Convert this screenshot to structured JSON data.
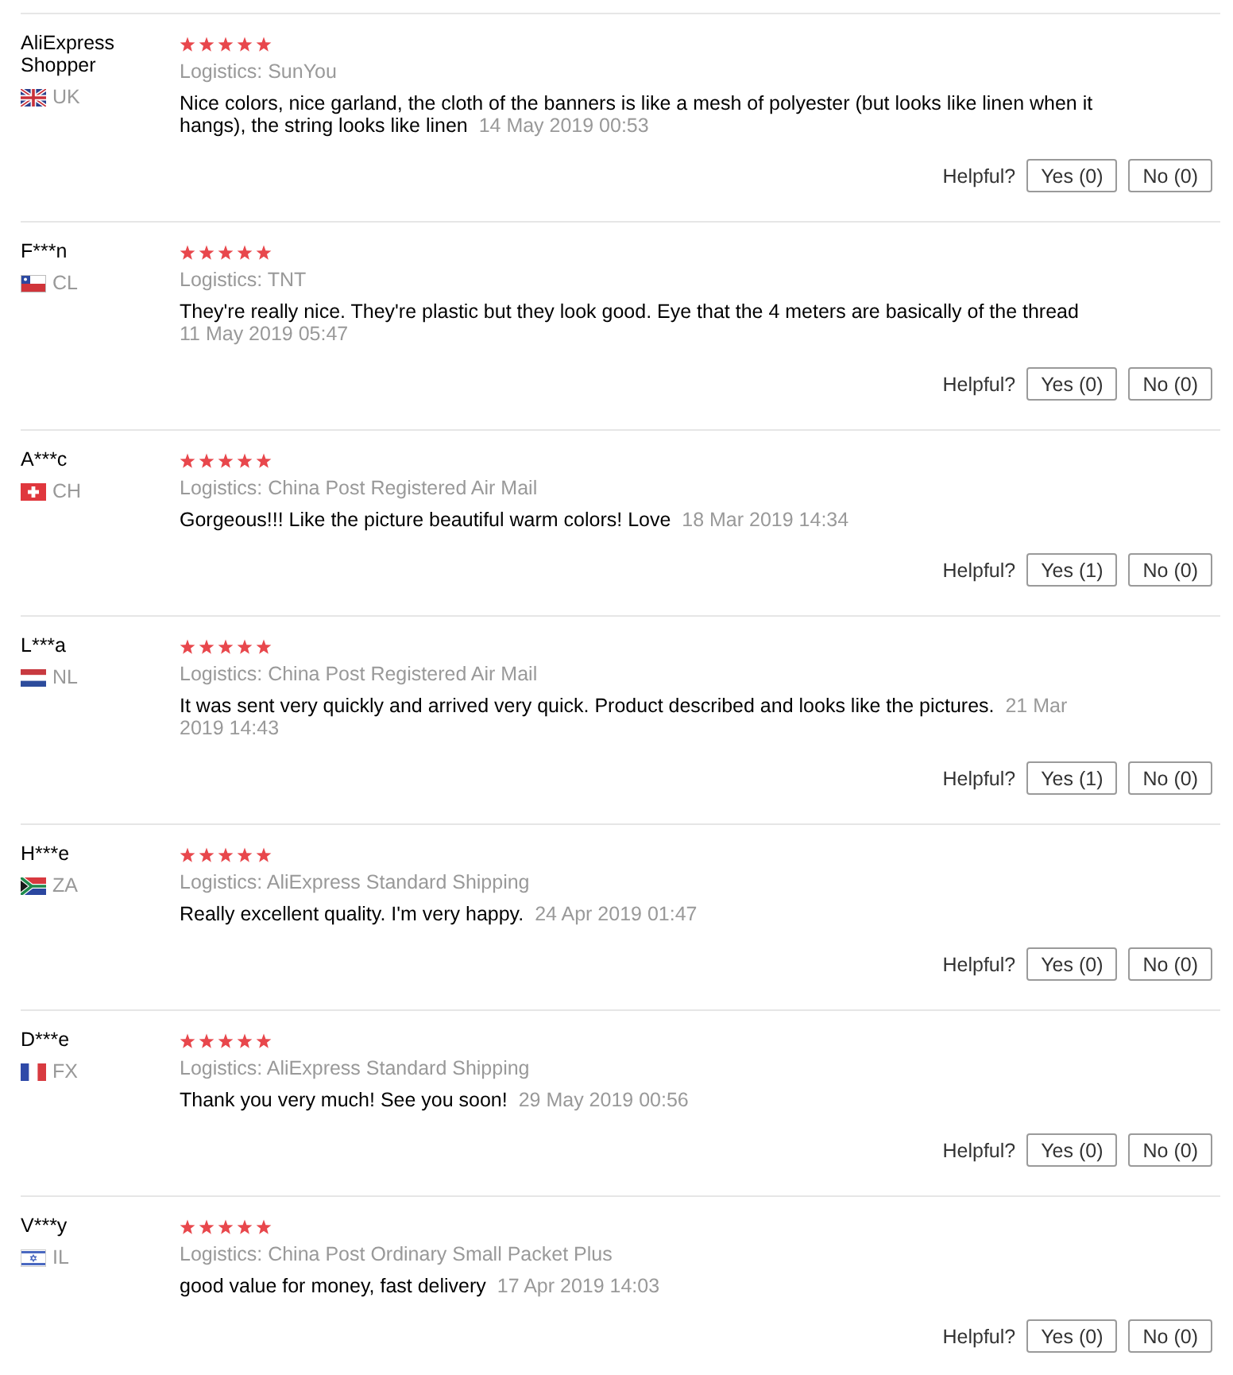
{
  "reviews": [
    {
      "name": "AliExpress Shopper",
      "country": "UK",
      "stars": 5,
      "logistics": "Logistics: SunYou",
      "text": "Nice colors, nice garland, the cloth of the banners is like a mesh of polyester (but looks like linen when it hangs), the string looks like linen",
      "date": "14 May 2019 00:53",
      "helpful_label": "Helpful?",
      "yes": "Yes (0)",
      "no": "No (0)"
    },
    {
      "name": "F***n",
      "country": "CL",
      "stars": 5,
      "logistics": "Logistics: TNT",
      "text": "They're really nice. They're plastic but they look good. Eye that the 4 meters are basically of the thread",
      "date": "11 May 2019 05:47",
      "helpful_label": "Helpful?",
      "yes": "Yes (0)",
      "no": "No (0)"
    },
    {
      "name": "A***c",
      "country": "CH",
      "stars": 5,
      "logistics": "Logistics: China Post Registered Air Mail",
      "text": "Gorgeous!!! Like the picture beautiful warm colors! Love",
      "date": "18 Mar 2019 14:34",
      "helpful_label": "Helpful?",
      "yes": "Yes (1)",
      "no": "No (0)"
    },
    {
      "name": "L***a",
      "country": "NL",
      "stars": 5,
      "logistics": "Logistics: China Post Registered Air Mail",
      "text": "It was sent very quickly and arrived very quick. Product described and looks like the pictures.",
      "date": "21 Mar 2019 14:43",
      "helpful_label": "Helpful?",
      "yes": "Yes (1)",
      "no": "No (0)"
    },
    {
      "name": "H***e",
      "country": "ZA",
      "stars": 5,
      "logistics": "Logistics: AliExpress Standard Shipping",
      "text": "Really excellent quality. I'm very happy.",
      "date": "24 Apr 2019 01:47",
      "helpful_label": "Helpful?",
      "yes": "Yes (0)",
      "no": "No (0)"
    },
    {
      "name": "D***e",
      "country": "FX",
      "stars": 5,
      "logistics": "Logistics: AliExpress Standard Shipping",
      "text": "Thank you very much! See you soon!",
      "date": "29 May 2019 00:56",
      "helpful_label": "Helpful?",
      "yes": "Yes (0)",
      "no": "No (0)"
    },
    {
      "name": "V***y",
      "country": "IL",
      "stars": 5,
      "logistics": "Logistics: China Post Ordinary Small Packet Plus",
      "text": "good value for money, fast delivery",
      "date": "17 Apr 2019 14:03",
      "helpful_label": "Helpful?",
      "yes": "Yes (0)",
      "no": "No (0)"
    }
  ]
}
